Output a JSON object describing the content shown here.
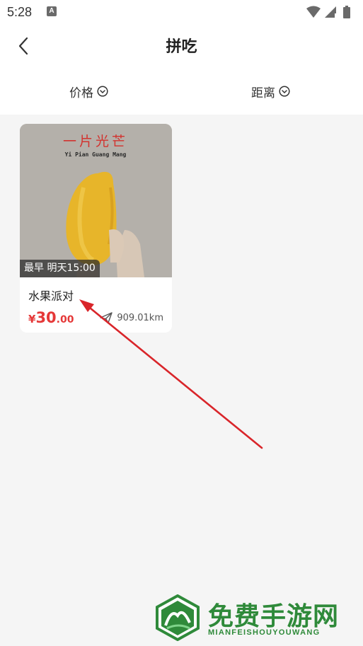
{
  "status_bar": {
    "time": "5:28",
    "notification_letter": "A",
    "icons": [
      "wifi-icon",
      "signal-icon",
      "battery-icon"
    ]
  },
  "nav": {
    "title": "拼吃",
    "back_icon": "chevron-left-icon"
  },
  "filters": [
    {
      "label": "价格",
      "icon": "chevron-down-circle-icon"
    },
    {
      "label": "距离",
      "icon": "chevron-down-circle-icon"
    }
  ],
  "card": {
    "image_caption_cn": "一片光芒",
    "image_caption_en": "Yi Pian Guang Mang",
    "time_badge": "最早 明天15:00",
    "title": "水果派对",
    "price_currency": "¥",
    "price_integer": "30",
    "price_decimal": ".00",
    "distance": "909.01km",
    "distance_icon": "send-icon"
  },
  "watermark": {
    "text": "免费手游网",
    "subtext": "MIANFEISHOUYOUWANG"
  },
  "colors": {
    "price": "#e53838",
    "arrow": "#d9252a",
    "watermark": "#2f8a3a"
  }
}
